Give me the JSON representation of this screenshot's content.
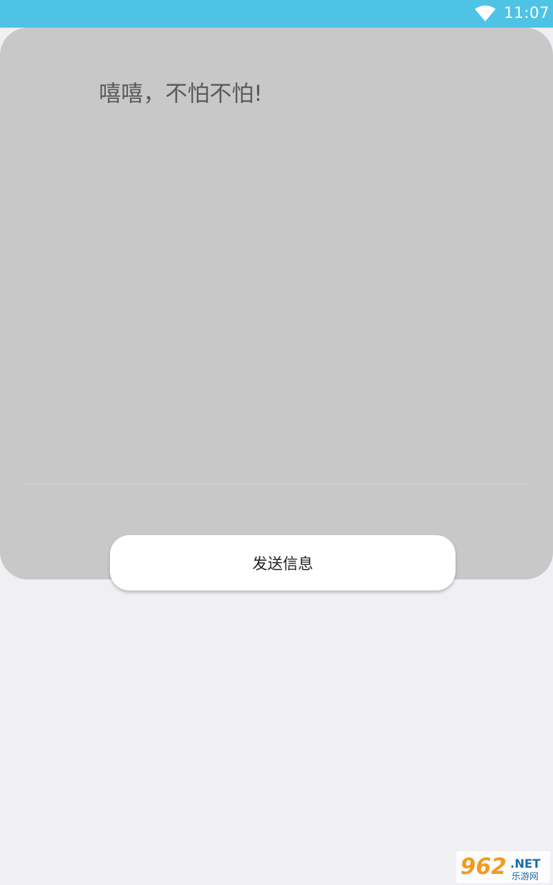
{
  "status_bar": {
    "time": "11:07",
    "wifi_icon": "wifi-icon",
    "background_color": "#4fc3e6"
  },
  "message": {
    "text": "嘻嘻，不怕不怕!"
  },
  "send_button": {
    "label": "发送信息"
  },
  "watermark": {
    "brand_number": "962",
    "brand_suffix": ".NET",
    "brand_name": "乐游网"
  },
  "colors": {
    "page_background": "#efeff4",
    "card_background": "#c8c8c8",
    "accent": "#4fc3e6",
    "watermark_orange": "#f39a1e"
  }
}
